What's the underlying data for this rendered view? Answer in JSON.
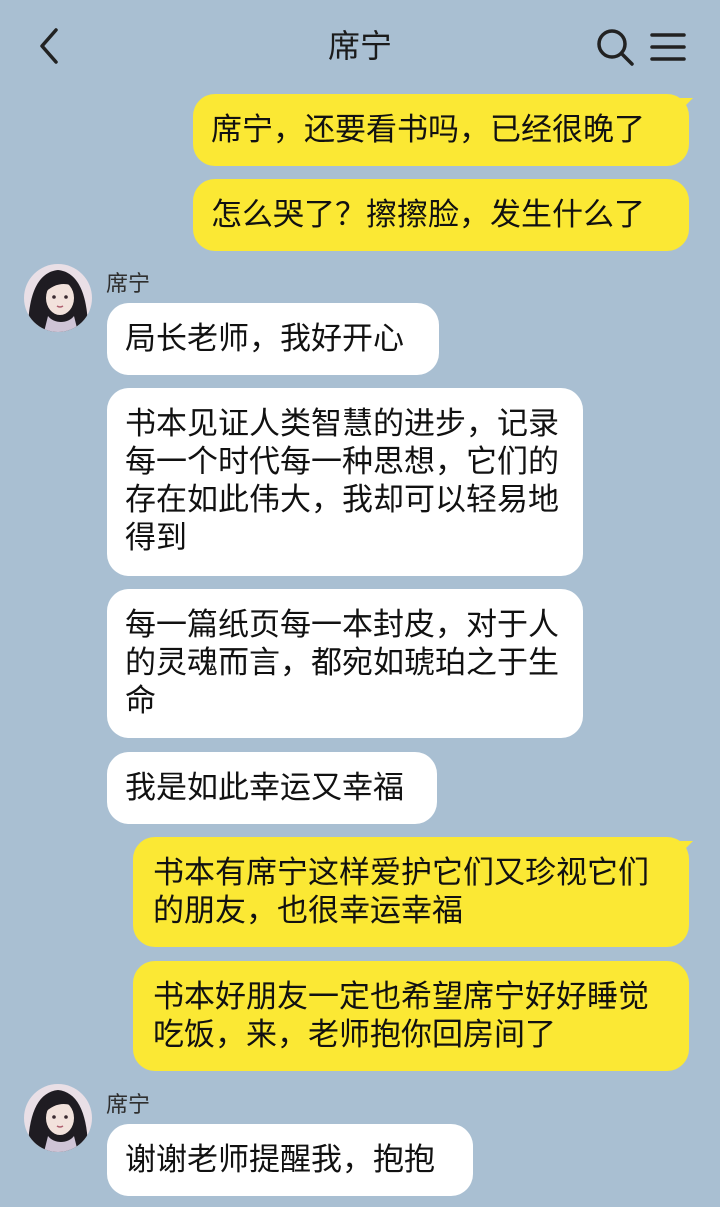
{
  "header": {
    "title": "席宁"
  },
  "icons": {
    "back": "chevron-left-icon",
    "search": "search-icon",
    "menu": "menu-icon"
  },
  "colors": {
    "background": "#a9bfd2",
    "outgoing_bubble": "#fbe834",
    "incoming_bubble": "#ffffff"
  },
  "messages": [
    {
      "side": "out",
      "text": "席宁，还要看书吗，已经很晚了"
    },
    {
      "side": "out",
      "text": "怎么哭了？擦擦脸，发生什么了"
    },
    {
      "side": "in",
      "sender": "席宁",
      "text": "局长老师，我好开心"
    },
    {
      "side": "in",
      "text": "书本见证人类智慧的进步，记录每一个时代每一种思想，它们的存在如此伟大，我却可以轻易地得到"
    },
    {
      "side": "in",
      "text": "每一篇纸页每一本封皮，对于人的灵魂而言，都宛如琥珀之于生命"
    },
    {
      "side": "in",
      "text": "我是如此幸运又幸福"
    },
    {
      "side": "out",
      "text": "书本有席宁这样爱护它们又珍视它们的朋友，也很幸运幸福"
    },
    {
      "side": "out",
      "text": "书本好朋友一定也希望席宁好好睡觉吃饭，来，老师抱你回房间了"
    },
    {
      "side": "in",
      "sender": "席宁",
      "text": "谢谢老师提醒我，抱抱"
    }
  ]
}
